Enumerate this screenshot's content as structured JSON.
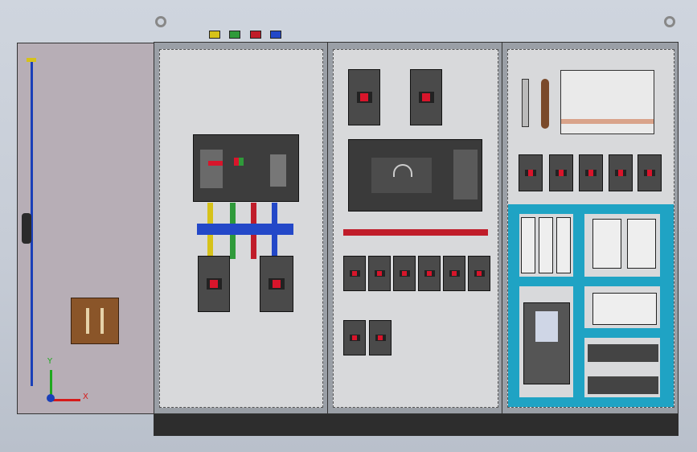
{
  "colors": {
    "phase_yellow": "#d6c21a",
    "phase_green": "#2f9a3a",
    "phase_red": "#c01d2a",
    "phase_blue": "#2348c8",
    "wiring_channel": "#1fa3c4",
    "cabinet_frame": "#9a9fa6",
    "mounting_plate": "#d8d9db",
    "door_panel": "#b7aeb6"
  },
  "axis_triad": {
    "x_label": "X",
    "y_label": "Y"
  },
  "icons": {
    "lifting_eye": "lifting-eye-icon",
    "axis_triad": "axis-triad-icon"
  }
}
